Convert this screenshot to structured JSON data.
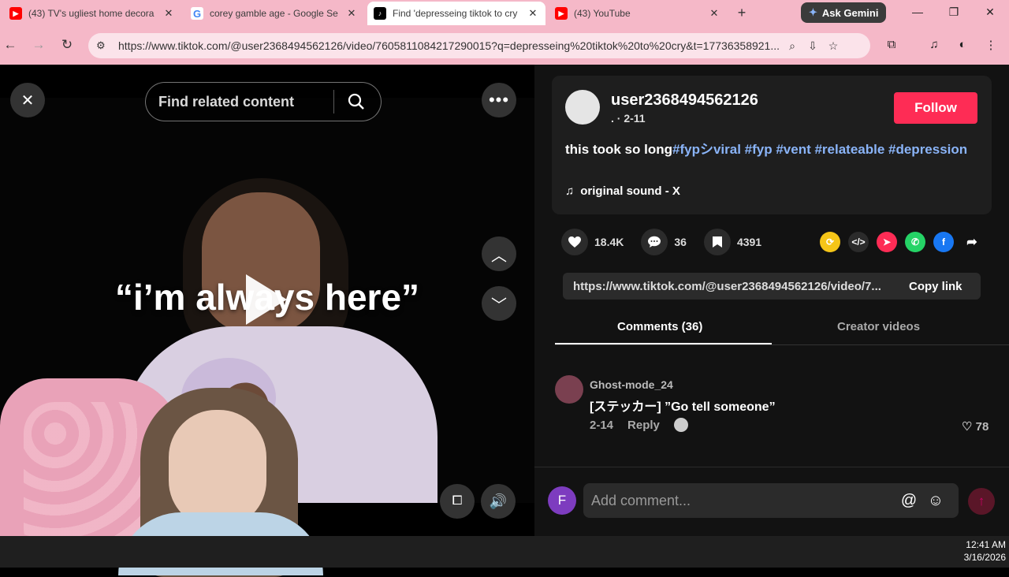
{
  "browser": {
    "tabs": [
      {
        "title": "(43) TV's ugliest home decora",
        "icon": "youtube-icon"
      },
      {
        "title": "corey gamble age - Google Se",
        "icon": "google-icon"
      },
      {
        "title": "Find 'depresseing tiktok to cry",
        "icon": "tiktok-icon"
      },
      {
        "title": "(43) YouTube",
        "icon": "youtube-icon"
      }
    ],
    "gemini_label": "Ask Gemini",
    "url": "https://www.tiktok.com/@user2368494562126/video/7605811084217290015?q=depresseing%20tiktok%20to%20cry&t=17736358921..."
  },
  "player": {
    "search_placeholder": "Find related content",
    "caption": "“i’m always here”"
  },
  "video_info": {
    "username": "user2368494562126",
    "date": ". · 2-11",
    "follow_label": "Follow",
    "desc_text": "this took so long",
    "desc_tags": "#fypシviral #fyp #vent #relateable #depression",
    "sound": "original sound - X"
  },
  "stats": {
    "likes": "18.4K",
    "comments": "36",
    "saves": "4391"
  },
  "link": {
    "url": "https://www.tiktok.com/@user2368494562126/video/7...",
    "copy_label": "Copy link"
  },
  "tabs": {
    "comments": "Comments (36)",
    "creator": "Creator videos"
  },
  "comments": [
    {
      "user": "Ghost-mode_24",
      "text": "[ステッカー] ”Go tell someone”",
      "date": "2-14",
      "reply": "Reply",
      "likes": "78"
    }
  ],
  "comment_input": {
    "avatar_letter": "F",
    "placeholder": "Add comment..."
  },
  "taskbar": {
    "time": "12:41 AM",
    "date": "3/16/2026"
  },
  "colors": {
    "accent": "#fe2c55",
    "chrome_bg": "#f5b8c8",
    "hashtag": "#8ab4f8"
  }
}
